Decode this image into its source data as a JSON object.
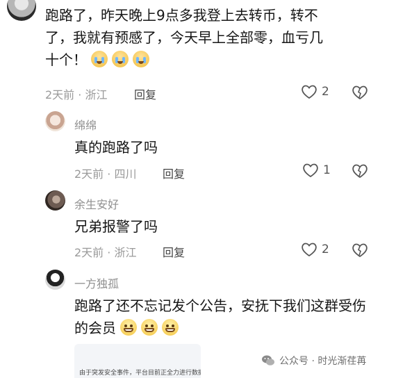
{
  "comments": [
    {
      "text": "跑路了，昨天晚上9点多我登上去转币，转不了，我就有预感了，今天早上全部零，血亏几十个！",
      "meta": "2天前 · 浙江",
      "reply_label": "回复",
      "like_count": "2",
      "emojis": [
        "cry",
        "cry",
        "cry"
      ]
    }
  ],
  "replies": [
    {
      "username": "绵绵",
      "text": "真的跑路了吗",
      "meta": "2天前 · 四川",
      "reply_label": "回复",
      "like_count": "1"
    },
    {
      "username": "余生安好",
      "text": "兄弟报警了吗",
      "meta": "2天前 · 浙江",
      "reply_label": "回复",
      "like_count": "2"
    },
    {
      "username": "一方独孤",
      "text": "跑路了还不忘记发个公告，安抚下我们这群受伤的会员",
      "emojis": [
        "grin",
        "grin",
        "grin"
      ],
      "image_preview_text": "由于突发安全事件，平台目前正全力进行数据"
    }
  ],
  "watermark": "公众号 · 时光渐荏苒",
  "icons": {
    "like": "heart-outline-icon",
    "dislike": "broken-heart-icon",
    "watermark": "wechat-icon"
  }
}
